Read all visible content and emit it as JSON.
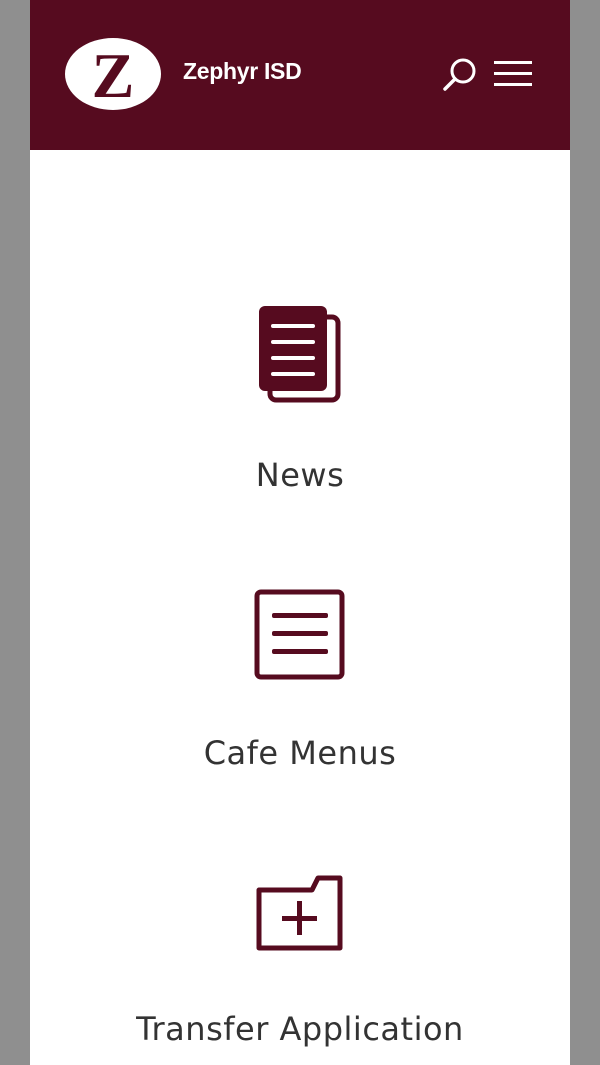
{
  "header": {
    "site_name": "Zephyr ISD",
    "logo_letter": "Z",
    "background_color": "#560b1f"
  },
  "icons": {
    "search": "search-icon",
    "menu": "hamburger-menu-icon"
  },
  "quick_links": [
    {
      "label": "News",
      "icon": "documents-icon"
    },
    {
      "label": "Cafe Menus",
      "icon": "menu-list-icon"
    },
    {
      "label": "Transfer Application",
      "icon": "folder-add-icon"
    }
  ],
  "colors": {
    "accent": "#560b1f",
    "text": "#333333",
    "page_background": "#ffffff",
    "outer_background": "#8f8f8f"
  }
}
